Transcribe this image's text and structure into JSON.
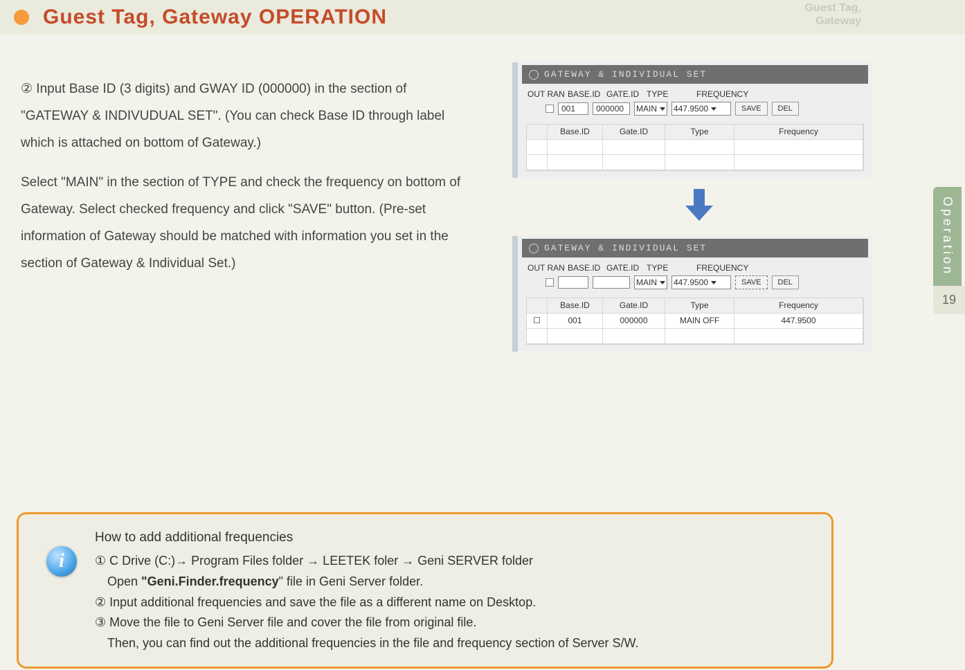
{
  "header": {
    "title": "Guest Tag, Gateway OPERATION",
    "right_line1": "Guest Tag,",
    "right_line2": "Gateway"
  },
  "side": {
    "tab_label": "Operation",
    "page": "19"
  },
  "body": {
    "para1": "② Input Base ID (3 digits) and GWAY ID (000000) in the section of \"GATEWAY & INDIVUDUAL SET\". (You can check Base ID through label which is attached on bottom of Gateway.)",
    "para2": " Select \"MAIN\" in the section of TYPE and check the frequency on bottom of Gateway. Select checked frequency and click \"SAVE\" button. (Pre-set information of Gateway should be matched with information you set in the section of Gateway & Individual Set.)"
  },
  "panel": {
    "dlg_title": "GATEWAY & INDIVIDUAL SET",
    "labels": {
      "outran": "OUT RAN",
      "baseid": "BASE.ID",
      "gateid": "GATE.ID",
      "type": "TYPE",
      "freq": "FREQUENCY"
    },
    "top": {
      "base": "001",
      "gate": "000000",
      "type": "MAIN",
      "freq": "447.9500",
      "save": "SAVE",
      "del": "DEL",
      "grid_headers": {
        "chk": "",
        "base": "Base.ID",
        "gate": "Gate.ID",
        "type": "Type",
        "freq": "Frequency"
      }
    },
    "bottom": {
      "base": "",
      "gate": "",
      "type": "MAIN",
      "freq": "447.9500",
      "save": "SAVE",
      "del": "DEL",
      "grid_headers": {
        "chk": "",
        "base": "Base.ID",
        "gate": "Gate.ID",
        "type": "Type",
        "freq": "Frequency"
      },
      "row": {
        "chk": "☐",
        "base": "001",
        "gate": "000000",
        "type": "MAIN OFF",
        "freq": "447.9500"
      }
    }
  },
  "info": {
    "title": "How to add additional frequencies",
    "l1": "① C Drive (C:)→ Program Files folder → LEETEK foler → Geni SERVER folder",
    "l2a": "Open ",
    "l2b": "\"Geni.Finder.frequency",
    "l2c": "\" file in Geni Server folder.",
    "l3": "② Input additional frequencies and save the file as a different name on Desktop.",
    "l4": "③ Move the file to Geni Server file and cover the file from original file.",
    "l5": "Then, you can find out the additional frequencies in the file and frequency section of Server S/W."
  }
}
